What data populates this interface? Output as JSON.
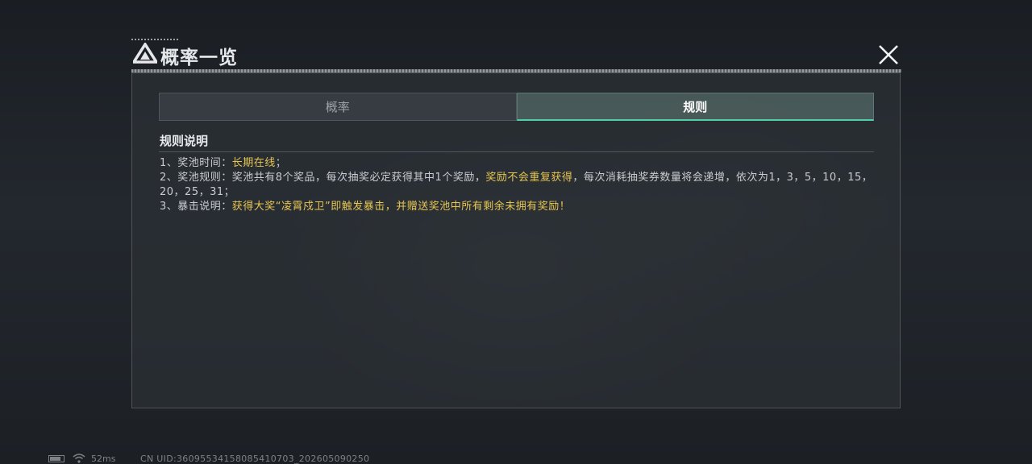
{
  "header": {
    "title": "概率一览",
    "logo_icon": "triangle-logo-icon",
    "close_icon": "close-icon"
  },
  "tabs": [
    {
      "label": "概率",
      "active": false
    },
    {
      "label": "规则",
      "active": true
    }
  ],
  "rules": {
    "section_title": "规则说明",
    "line1": {
      "prefix": "1、奖池时间：",
      "highlight": "长期在线",
      "suffix": "；"
    },
    "line2": {
      "prefix": "2、奖池规则：奖池共有8个奖品，每次抽奖必定获得其中1个奖励，",
      "highlight": "奖励不会重复获得",
      "suffix": "，每次消耗抽奖券数量将会递增，依次为1，3，5，10，15，20，25，31；"
    },
    "line3": {
      "prefix": "3、暴击说明：",
      "highlight": "获得大奖“凌霄戍卫”即触发暴击，并赠送奖池中所有剩余未拥有奖励！",
      "suffix": ""
    }
  },
  "status_bar": {
    "ping": "52ms",
    "uid": "CN UID:36095534158085410703_202605090250",
    "battery_level": 0.8
  },
  "colors": {
    "highlight": "#e6c552",
    "tab_accent": "#4fcfa8"
  }
}
